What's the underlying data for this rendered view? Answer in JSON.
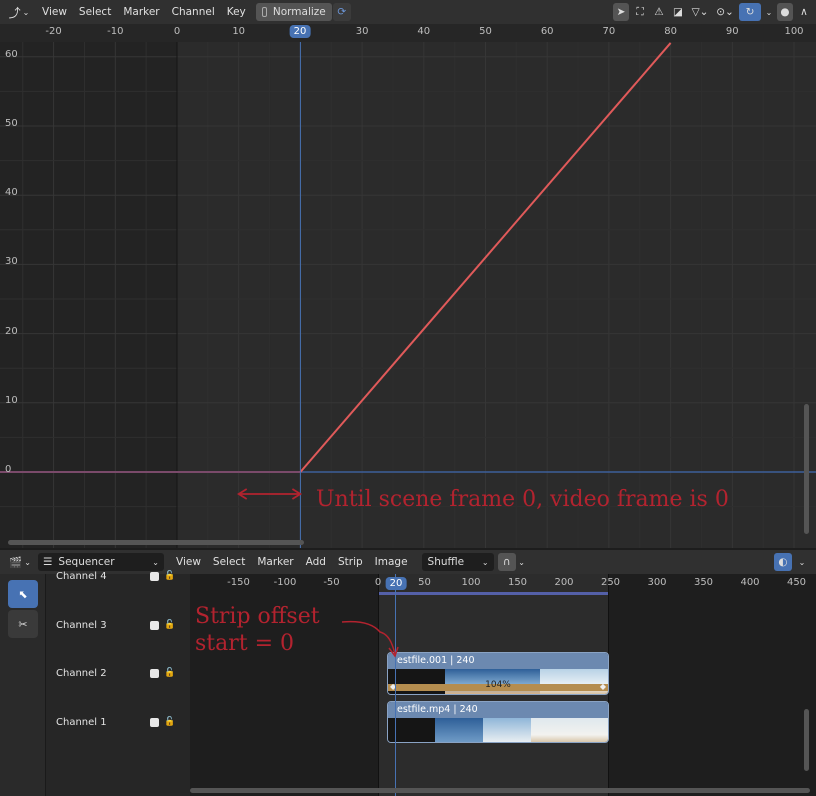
{
  "graph_editor": {
    "menu": [
      "View",
      "Select",
      "Marker",
      "Channel",
      "Key"
    ],
    "normalize_label": "Normalize",
    "x_ticks": [
      "-20",
      "-10",
      "0",
      "10",
      "20",
      "30",
      "40",
      "50",
      "60",
      "70",
      "80",
      "90",
      "100"
    ],
    "y_ticks": [
      "60",
      "50",
      "40",
      "30",
      "20",
      "10",
      "0"
    ],
    "current_frame": "20",
    "annotation": "Until scene frame 0, video frame is 0",
    "curve_color": "#e05a5a",
    "playhead_color": "#4772b3"
  },
  "sequencer": {
    "editor_type": "Sequencer",
    "menu": [
      "View",
      "Select",
      "Marker",
      "Add",
      "Strip",
      "Image"
    ],
    "shuffle_label": "Shuffle",
    "x_ticks": [
      "-150",
      "-100",
      "-50",
      "0",
      "20",
      "50",
      "100",
      "150",
      "200",
      "250",
      "300",
      "350",
      "400",
      "450"
    ],
    "current_frame": "20",
    "channels": [
      {
        "name": "Channel 4"
      },
      {
        "name": "Channel 3"
      },
      {
        "name": "Channel 2"
      },
      {
        "name": "Channel 1"
      }
    ],
    "strips": [
      {
        "name": "estfile.001 | 240",
        "speed": "104%"
      },
      {
        "name": "estfile.mp4 | 240"
      }
    ],
    "annotation_line1": "Strip offset",
    "annotation_line2": "start = 0"
  }
}
